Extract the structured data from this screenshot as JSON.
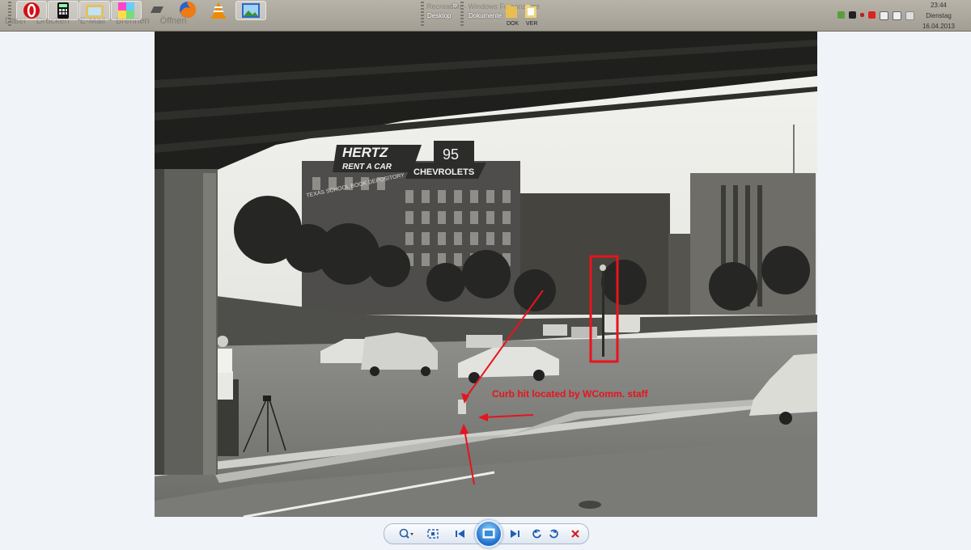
{
  "taskbar": {
    "ghost_menu": [
      "Datei",
      "Drucken",
      "E-Mail",
      "Brennen",
      "Öffnen"
    ],
    "ghost_window_title": "Recreation - Windows Fotoanzeige",
    "locations": [
      "Desktop",
      "Dokumente"
    ],
    "folders": [
      "DOK",
      "VER"
    ],
    "clock": {
      "time": "23:44",
      "day": "Dienstag",
      "date": "16.04.2013"
    }
  },
  "photo": {
    "annotation": "Curb hit located by WComm. staff",
    "sign_line1": "HERTZ",
    "sign_line2": "RENT A CAR",
    "sign_number": "95",
    "sign_right": "CHEVROLETS",
    "building_sign": "TEXAS SCHOOL BOOK DEPOSITORY",
    "colors": {
      "annotation": "#e8141c",
      "highlight_box": "#e8141c"
    }
  },
  "toolbar": {
    "icons": [
      "zoom-icon",
      "fit-to-window-icon",
      "previous-icon",
      "slideshow-icon",
      "next-icon",
      "rotate-left-icon",
      "rotate-right-icon",
      "delete-icon"
    ]
  }
}
